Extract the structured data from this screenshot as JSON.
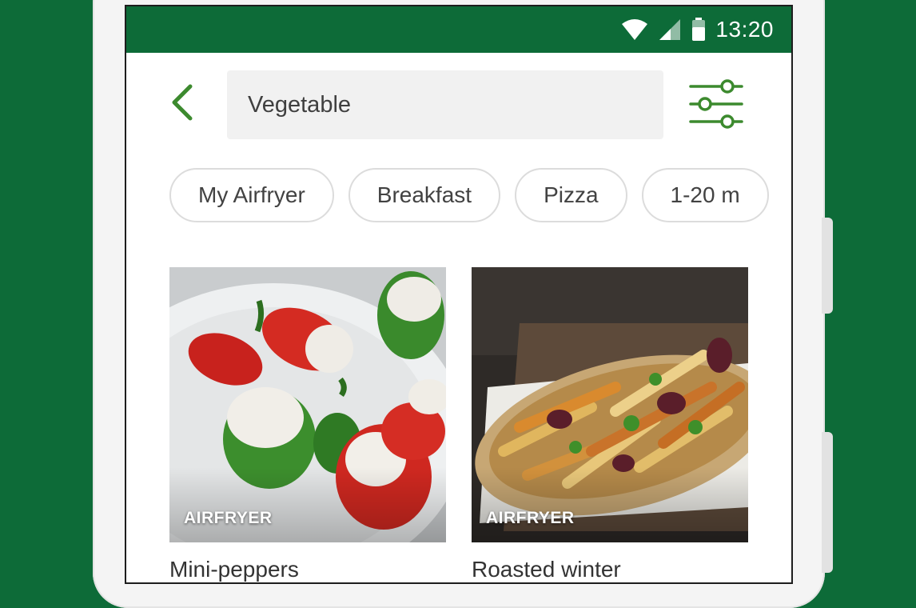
{
  "status_bar": {
    "time": "13:20",
    "icons": [
      "wifi-icon",
      "cell-signal-icon",
      "battery-icon"
    ],
    "background": "#0d6b38"
  },
  "search": {
    "back_icon": "chevron-left-icon",
    "query": "Vegetable",
    "filter_icon": "sliders-icon"
  },
  "chips": [
    "My Airfryer",
    "Breakfast",
    "Pizza",
    "1-20 m"
  ],
  "recipes": [
    {
      "tag": "AIRFRYER",
      "title": "Mini-peppers"
    },
    {
      "tag": "AIRFRYER",
      "title": "Roasted winter"
    }
  ],
  "colors": {
    "accent": "#3c8a2e",
    "brand": "#0d6b38"
  }
}
